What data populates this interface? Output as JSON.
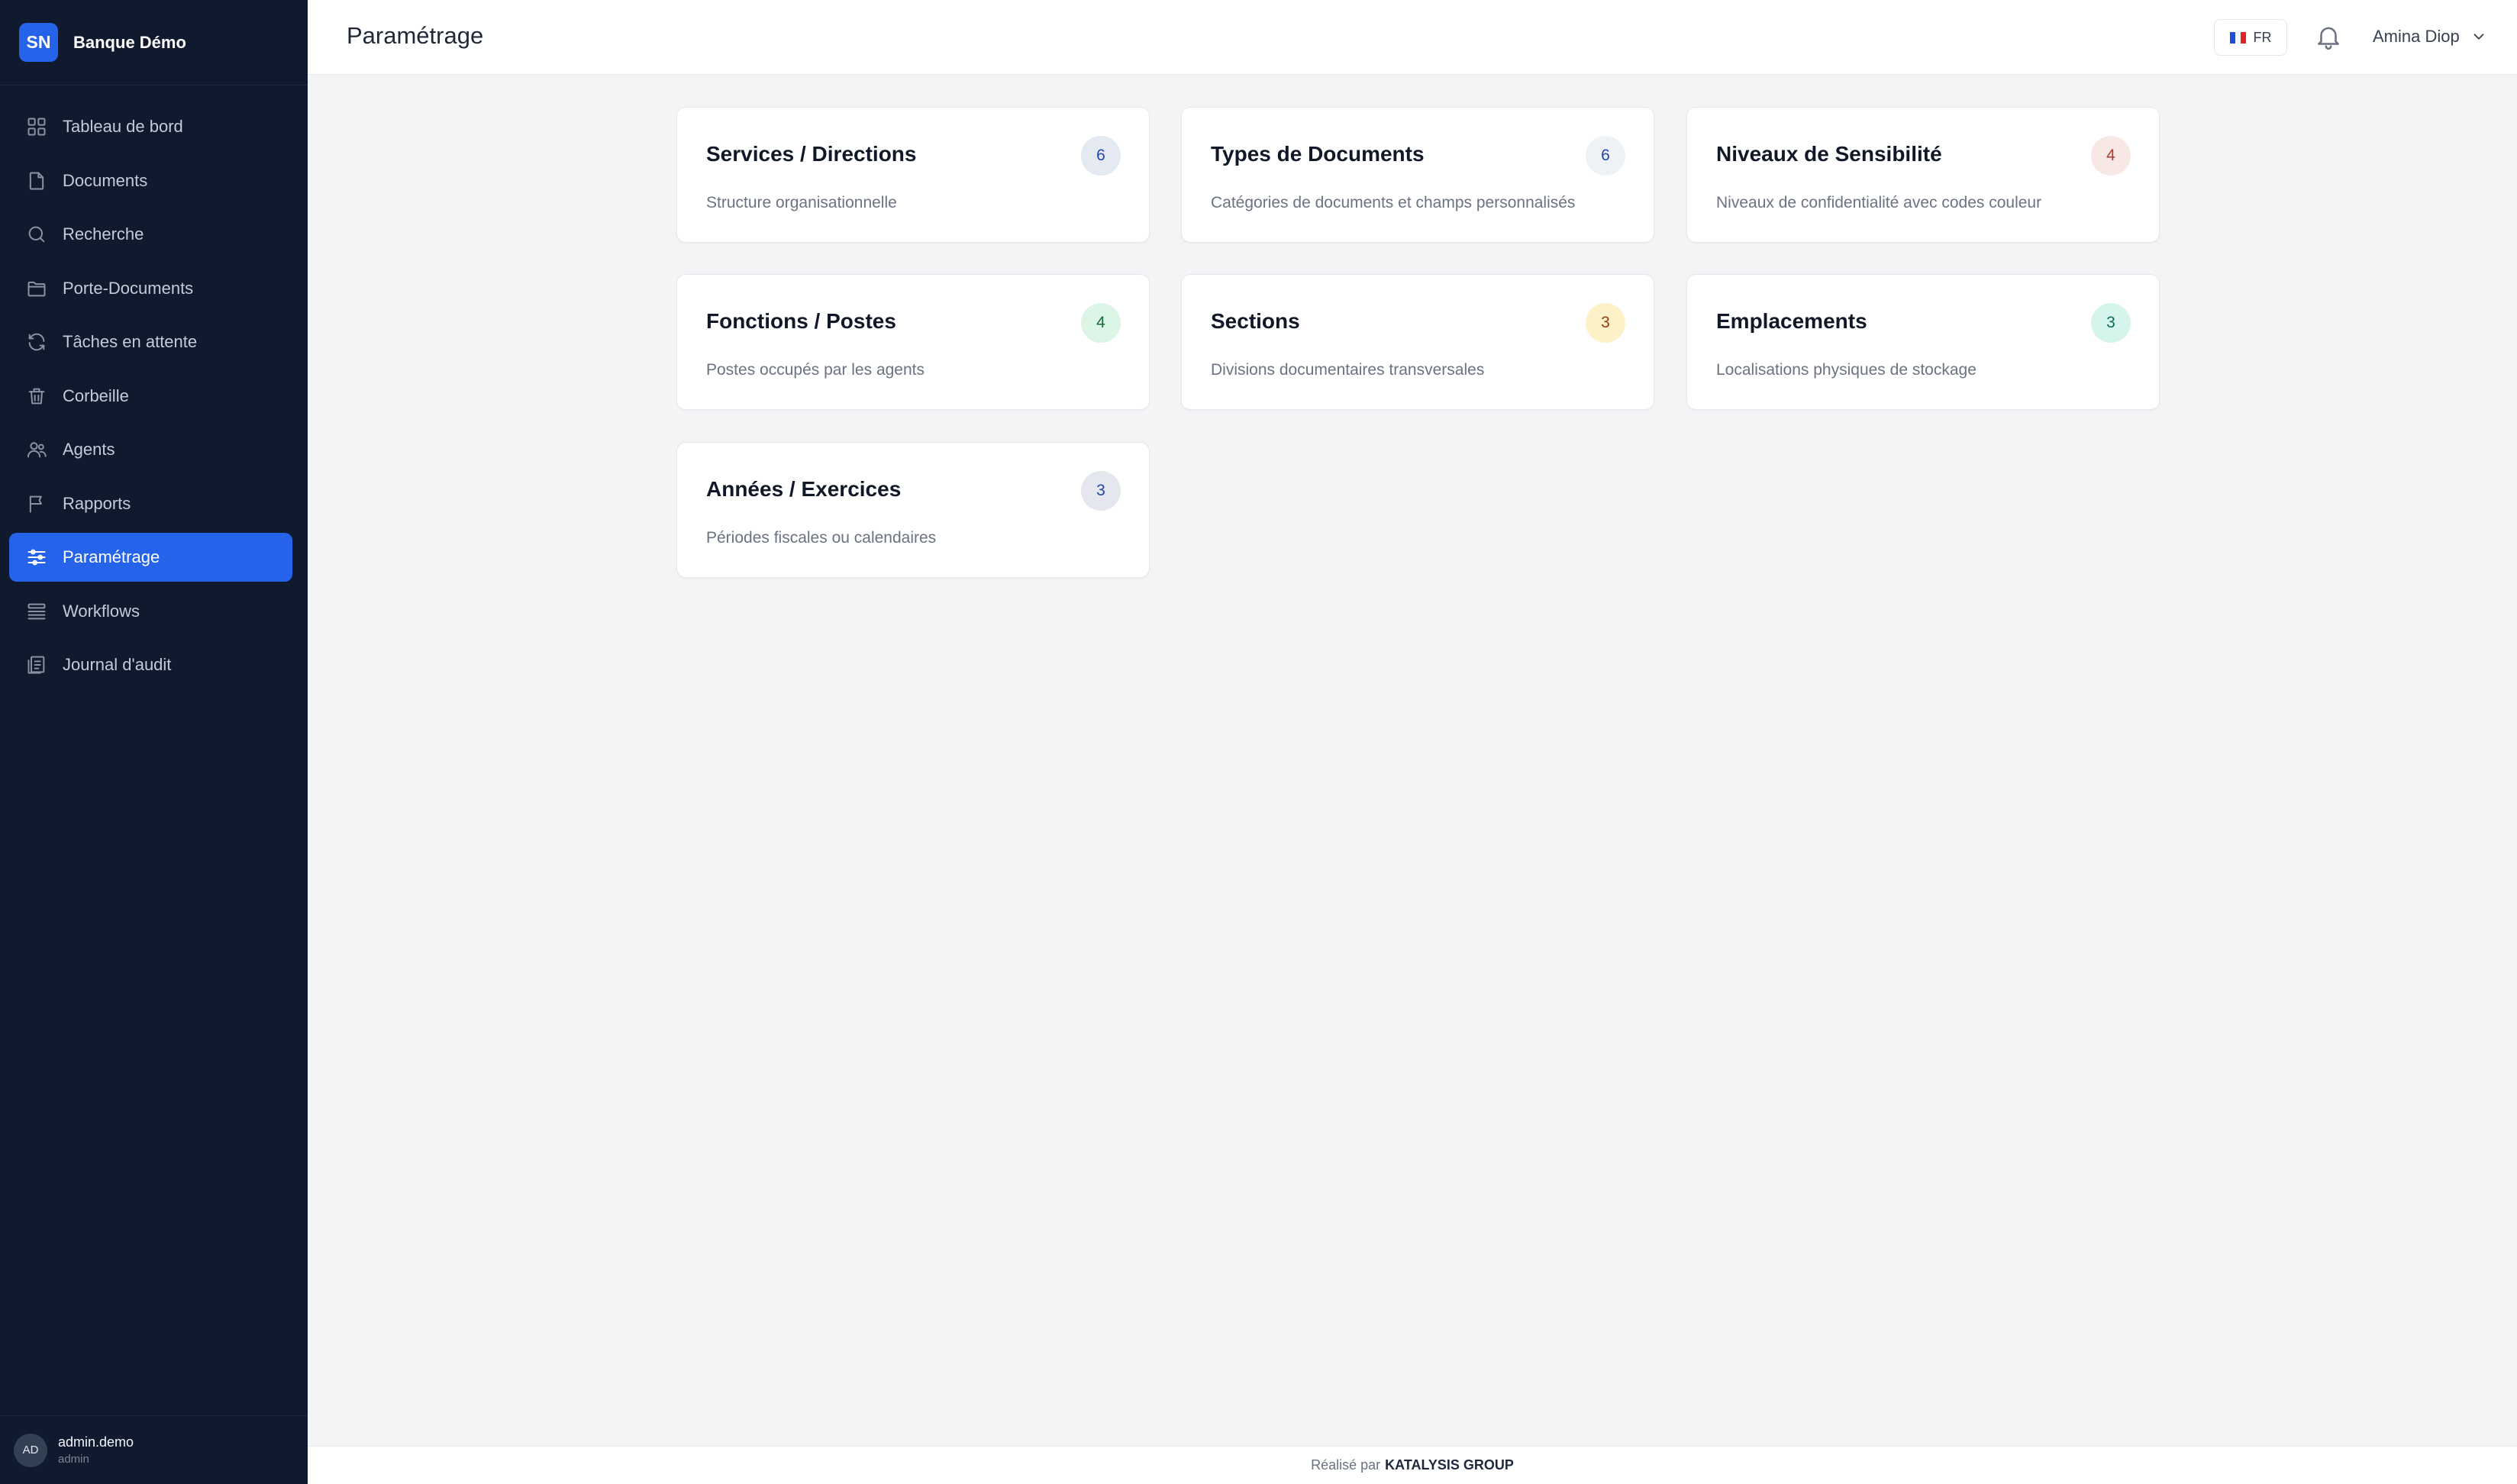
{
  "sidebar": {
    "brand": {
      "initials": "SN",
      "name": "Banque Démo"
    },
    "items": [
      {
        "label": "Tableau de bord",
        "icon": "grid-icon"
      },
      {
        "label": "Documents",
        "icon": "file-icon"
      },
      {
        "label": "Recherche",
        "icon": "search-icon"
      },
      {
        "label": "Porte-Documents",
        "icon": "folder-icon"
      },
      {
        "label": "Tâches en attente",
        "icon": "refresh-icon"
      },
      {
        "label": "Corbeille",
        "icon": "trash-icon"
      },
      {
        "label": "Agents",
        "icon": "users-icon"
      },
      {
        "label": "Rapports",
        "icon": "flag-icon"
      },
      {
        "label": "Paramétrage",
        "icon": "sliders-icon",
        "active": true
      },
      {
        "label": "Workflows",
        "icon": "stack-icon"
      },
      {
        "label": "Journal d'audit",
        "icon": "audit-icon"
      }
    ],
    "user": {
      "initials": "AD",
      "name": "admin.demo",
      "role": "admin"
    }
  },
  "header": {
    "title": "Paramétrage",
    "language": "FR",
    "user_name": "Amina Diop"
  },
  "cards": [
    {
      "title": "Services / Directions",
      "description": "Structure organisationnelle",
      "count": "6",
      "badge_bg": "#e5e9f2",
      "badge_fg": "#2346a8"
    },
    {
      "title": "Types de Documents",
      "description": "Catégories de documents et champs personnalisés",
      "count": "6",
      "badge_bg": "#eef1f6",
      "badge_fg": "#2346a8"
    },
    {
      "title": "Niveaux de Sensibilité",
      "description": "Niveaux de confidentialité avec codes couleur",
      "count": "4",
      "badge_bg": "#f7e8e5",
      "badge_fg": "#b03a2e"
    },
    {
      "title": "Fonctions / Postes",
      "description": "Postes occupés par les agents",
      "count": "4",
      "badge_bg": "#dcf5e6",
      "badge_fg": "#1b6b3a"
    },
    {
      "title": "Sections",
      "description": "Divisions documentaires transversales",
      "count": "3",
      "badge_bg": "#fdf2c7",
      "badge_fg": "#9a3b12"
    },
    {
      "title": "Emplacements",
      "description": "Localisations physiques de stockage",
      "count": "3",
      "badge_bg": "#d5f5ec",
      "badge_fg": "#0f6b5a"
    },
    {
      "title": "Années / Exercices",
      "description": "Périodes fiscales ou calendaires",
      "count": "3",
      "badge_bg": "#e4e7ee",
      "badge_fg": "#2346a8"
    }
  ],
  "footer": {
    "prefix": "Réalisé par",
    "company": "KATALYSIS GROUP"
  }
}
